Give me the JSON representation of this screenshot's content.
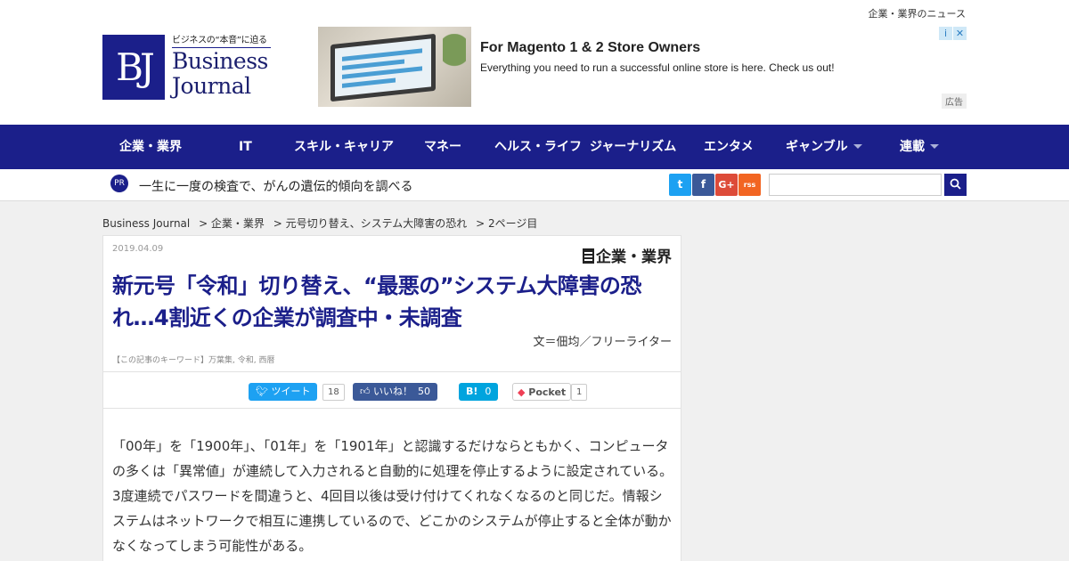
{
  "header": {
    "top_link": "企業・業界のニュース",
    "logo": {
      "tagline": "ビジネスの“本音”に迫る",
      "mark": "BJ",
      "word1": "Business",
      "word2": "Journal"
    }
  },
  "ad": {
    "title": "For Magento 1 & 2 Store Owners",
    "description": "Everything you need to run a successful online store is here. Check us out!",
    "label": "広告",
    "info_icon": "i",
    "close_icon": "✕"
  },
  "nav": {
    "items": [
      {
        "label": "企業・業界",
        "has_dropdown": false
      },
      {
        "label": "IT",
        "has_dropdown": false
      },
      {
        "label": "スキル・キャリア",
        "has_dropdown": false
      },
      {
        "label": "マネー",
        "has_dropdown": false
      },
      {
        "label": "ヘルス・ライフ",
        "has_dropdown": false
      },
      {
        "label": "ジャーナリズム",
        "has_dropdown": false
      },
      {
        "label": "エンタメ",
        "has_dropdown": false
      },
      {
        "label": "ギャンブル",
        "has_dropdown": true
      },
      {
        "label": "連載",
        "has_dropdown": true
      }
    ]
  },
  "subbar": {
    "pr_badge": "PR",
    "pr_text": "一生に一度の検査で、がんの遺伝的傾向を調べる",
    "social": {
      "twitter": "t",
      "facebook": "f",
      "google_plus": "G+",
      "rss": "rss"
    },
    "search_placeholder": "",
    "search_icon": "search"
  },
  "breadcrumb": [
    "Business Journal",
    "> 企業・業界",
    "> 元号切り替え、システム大障害の恐れ",
    "> 2ページ目"
  ],
  "article": {
    "date": "2019.04.09",
    "category": "企業・業界",
    "title": "新元号「令和」切り替え、“最悪の”システム大障害の恐れ…4割近くの企業が調査中・未調査",
    "author": "文＝佃均／フリーライター",
    "keywords": "【この記事のキーワード】万葉集, 令和, 西暦",
    "share": {
      "tweet_label": "ツイート",
      "tweet_count": "18",
      "like_label": "いいね！",
      "like_count": "50",
      "hatena_label": "B!",
      "hatena_count": "0",
      "pocket_label": "Pocket",
      "pocket_count": "1"
    },
    "body": "「00年」を「1900年」、「01年」を「1901年」と認識するだけならともかく、コンピュータの多くは「異常値」が連続して入力されると自動的に処理を停止するように設定されている。3度連続でパスワードを間違うと、4回目以後は受け付けてくれなくなるのと同じだ。情報システムはネットワークで相互に連携しているので、どこかのシステムが停止すると全体が動かなくなってしまう可能性がある。"
  },
  "colors": {
    "brand": "#1b1f8a",
    "twitter": "#1da1f2",
    "facebook": "#3b5998",
    "google_plus": "#dd4b39",
    "rss": "#f26522",
    "hatena": "#00a4de",
    "pocket": "#ef4056"
  }
}
